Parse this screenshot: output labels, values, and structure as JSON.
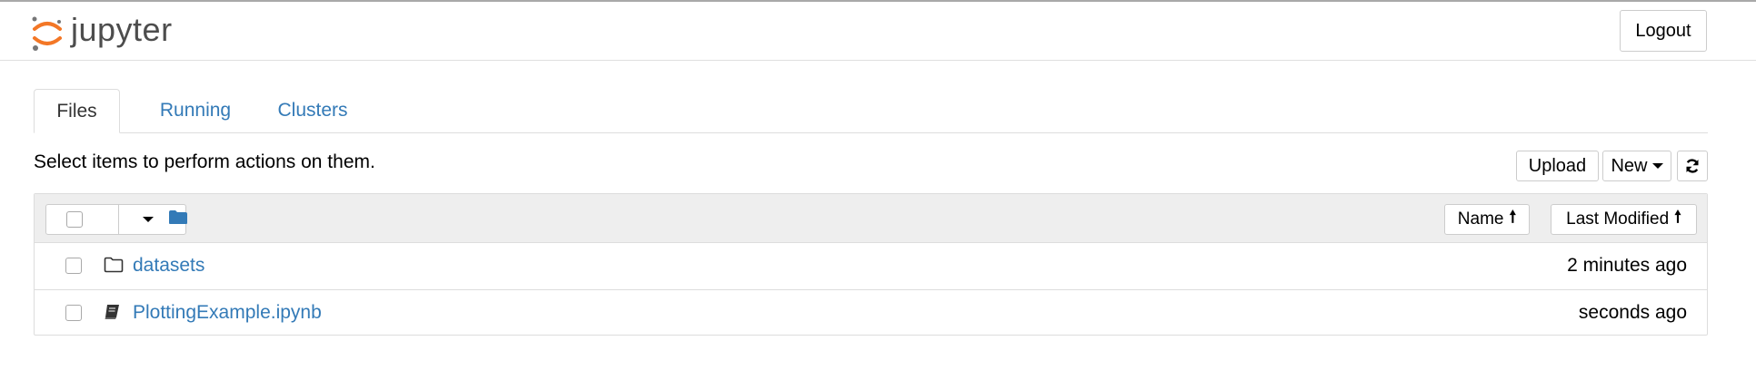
{
  "header": {
    "app_name": "jupyter",
    "logout_label": "Logout"
  },
  "tabs": [
    {
      "label": "Files",
      "active": true
    },
    {
      "label": "Running",
      "active": false
    },
    {
      "label": "Clusters",
      "active": false
    }
  ],
  "toolbar": {
    "instruction": "Select items to perform actions on them.",
    "upload_label": "Upload",
    "new_label": "New",
    "refresh_icon": "refresh-icon"
  },
  "list": {
    "header": {
      "folder_icon": "folder-icon",
      "sort_name_label": "Name",
      "sort_modified_label": "Last Modified"
    },
    "rows": [
      {
        "name": "datasets",
        "modified": "2 minutes ago",
        "icon": "folder-outline-icon"
      },
      {
        "name": "PlottingExample.ipynb",
        "modified": "seconds ago",
        "icon": "notebook-icon"
      }
    ]
  },
  "colors": {
    "link": "#337ab7",
    "accent": "#f37726",
    "header_bg": "#eeeeee"
  }
}
